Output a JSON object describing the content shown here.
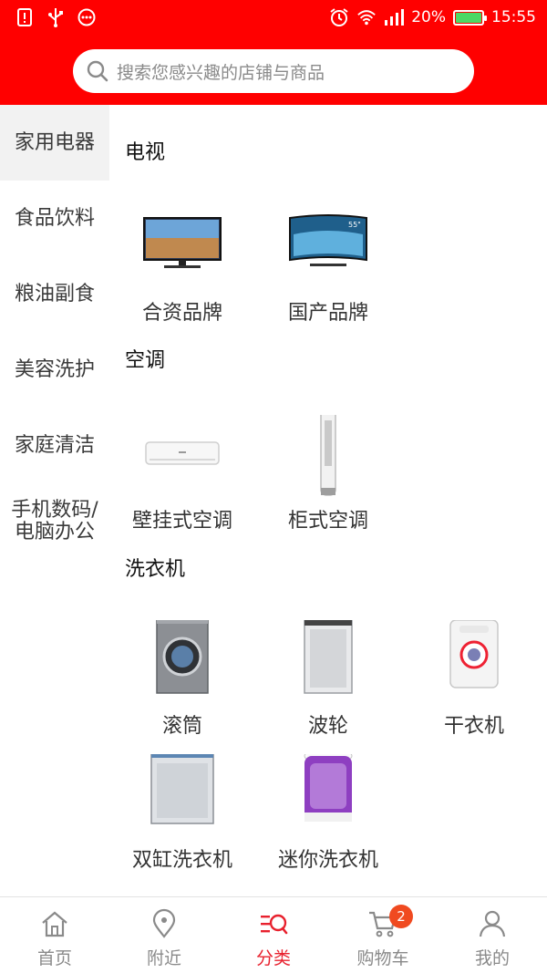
{
  "status_bar": {
    "battery": "20%",
    "time": "15:55",
    "icons": [
      "alert-icon",
      "usb-icon",
      "dots-icon",
      "alarm-icon",
      "wifi-icon",
      "signal-icon",
      "battery-icon"
    ],
    "battery_level": 0.2,
    "battery_color": "#4cd964"
  },
  "header": {
    "background": "#ff0000"
  },
  "search": {
    "placeholder": "搜索您感兴趣的店铺与商品"
  },
  "sidebar": {
    "items": [
      {
        "label": "家用电器",
        "active": true
      },
      {
        "label": "食品饮料"
      },
      {
        "label": "粮油副食"
      },
      {
        "label": "美容洗护"
      },
      {
        "label": "家庭清洁"
      },
      {
        "label": "手机数码/电脑办公"
      }
    ]
  },
  "sections": [
    {
      "title": "电视",
      "items": [
        {
          "label": "合资品牌"
        },
        {
          "label": "国产品牌"
        }
      ]
    },
    {
      "title": "空调",
      "items": [
        {
          "label": "壁挂式空调"
        },
        {
          "label": "柜式空调"
        }
      ]
    },
    {
      "title": "洗衣机",
      "items": [
        {
          "label": "滚筒"
        },
        {
          "label": "波轮"
        },
        {
          "label": "干衣机"
        },
        {
          "label": "双缸洗衣机"
        },
        {
          "label": "迷你洗衣机"
        }
      ]
    }
  ],
  "tabbar": {
    "items": [
      {
        "label": "首页",
        "icon": "home-icon"
      },
      {
        "label": "附近",
        "icon": "location-pin-icon"
      },
      {
        "label": "分类",
        "icon": "category-search-icon",
        "active": true
      },
      {
        "label": "购物车",
        "icon": "cart-icon",
        "badge": "2"
      },
      {
        "label": "我的",
        "icon": "user-icon"
      }
    ],
    "active_color": "#e8212e",
    "badge_color": "#f04a20"
  }
}
